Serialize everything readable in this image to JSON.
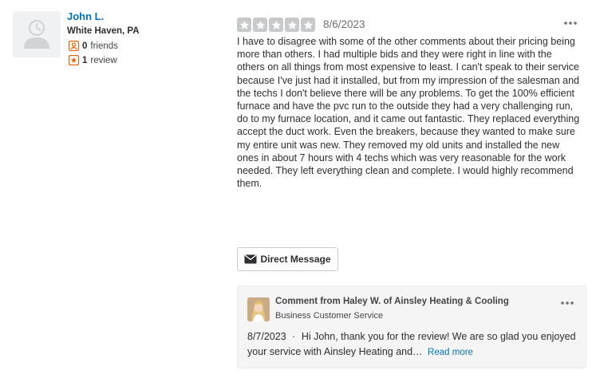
{
  "user": {
    "name": "John L.",
    "location": "White Haven, PA",
    "friends_count": "0",
    "friends_label": "friends",
    "reviews_count": "1",
    "reviews_label": "review"
  },
  "review": {
    "rating": 5,
    "rating_max": 5,
    "date": "8/6/2023",
    "text": "I have to disagree with some of the other comments about their pricing being more than others. I had multiple bids and they were right in line with the others on all things from most expensive to least. I can't speak to their service because I've just had it installed, but from my impression of the salesman and the techs I don't believe there will be any problems. To get the 100% efficient furnace and have the pvc run to the outside they had a very challenging run, do to my furnace location, and it came out fantastic. They replaced everything accept the duct work. Even the breakers, because they wanted to make sure my entire unit was new. They removed my old units and installed the new ones in about 7 hours with 4 techs which was very reasonable for the work needed. They left everything clean and complete. I would highly recommend them.",
    "star_color": "#c8c9ca"
  },
  "actions": {
    "direct_message_label": "Direct Message"
  },
  "business_comment": {
    "from": "Comment from Haley W. of Ainsley Heating & Cooling",
    "role": "Business Customer Service",
    "date": "8/7/2023",
    "separator": "·",
    "text": "Hi John, thank you for the review! We are so glad you enjoyed your service with Ainsley Heating and…",
    "read_more_label": "Read more"
  },
  "colors": {
    "link": "#0073bb",
    "badge_orange": "#f15c00"
  }
}
